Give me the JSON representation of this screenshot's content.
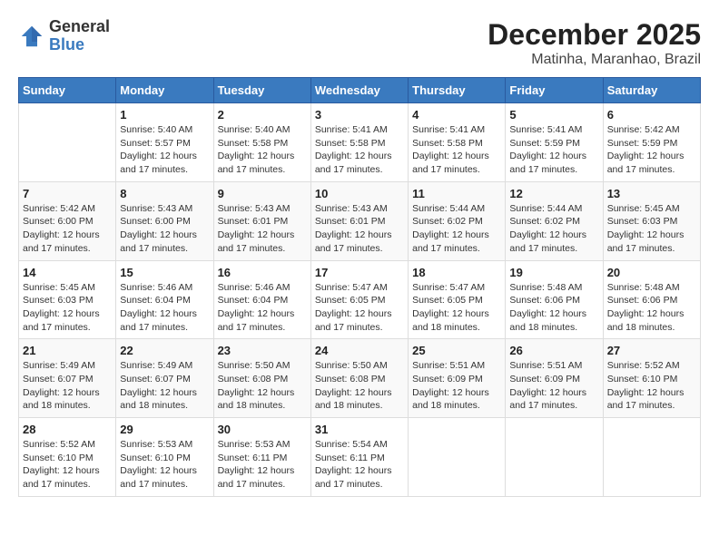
{
  "logo": {
    "general": "General",
    "blue": "Blue"
  },
  "title": {
    "month": "December 2025",
    "location": "Matinha, Maranhao, Brazil"
  },
  "weekdays": [
    "Sunday",
    "Monday",
    "Tuesday",
    "Wednesday",
    "Thursday",
    "Friday",
    "Saturday"
  ],
  "weeks": [
    [
      {
        "day": "",
        "info": ""
      },
      {
        "day": "1",
        "info": "Sunrise: 5:40 AM\nSunset: 5:57 PM\nDaylight: 12 hours\nand 17 minutes."
      },
      {
        "day": "2",
        "info": "Sunrise: 5:40 AM\nSunset: 5:58 PM\nDaylight: 12 hours\nand 17 minutes."
      },
      {
        "day": "3",
        "info": "Sunrise: 5:41 AM\nSunset: 5:58 PM\nDaylight: 12 hours\nand 17 minutes."
      },
      {
        "day": "4",
        "info": "Sunrise: 5:41 AM\nSunset: 5:58 PM\nDaylight: 12 hours\nand 17 minutes."
      },
      {
        "day": "5",
        "info": "Sunrise: 5:41 AM\nSunset: 5:59 PM\nDaylight: 12 hours\nand 17 minutes."
      },
      {
        "day": "6",
        "info": "Sunrise: 5:42 AM\nSunset: 5:59 PM\nDaylight: 12 hours\nand 17 minutes."
      }
    ],
    [
      {
        "day": "7",
        "info": "Sunrise: 5:42 AM\nSunset: 6:00 PM\nDaylight: 12 hours\nand 17 minutes."
      },
      {
        "day": "8",
        "info": "Sunrise: 5:43 AM\nSunset: 6:00 PM\nDaylight: 12 hours\nand 17 minutes."
      },
      {
        "day": "9",
        "info": "Sunrise: 5:43 AM\nSunset: 6:01 PM\nDaylight: 12 hours\nand 17 minutes."
      },
      {
        "day": "10",
        "info": "Sunrise: 5:43 AM\nSunset: 6:01 PM\nDaylight: 12 hours\nand 17 minutes."
      },
      {
        "day": "11",
        "info": "Sunrise: 5:44 AM\nSunset: 6:02 PM\nDaylight: 12 hours\nand 17 minutes."
      },
      {
        "day": "12",
        "info": "Sunrise: 5:44 AM\nSunset: 6:02 PM\nDaylight: 12 hours\nand 17 minutes."
      },
      {
        "day": "13",
        "info": "Sunrise: 5:45 AM\nSunset: 6:03 PM\nDaylight: 12 hours\nand 17 minutes."
      }
    ],
    [
      {
        "day": "14",
        "info": "Sunrise: 5:45 AM\nSunset: 6:03 PM\nDaylight: 12 hours\nand 17 minutes."
      },
      {
        "day": "15",
        "info": "Sunrise: 5:46 AM\nSunset: 6:04 PM\nDaylight: 12 hours\nand 17 minutes."
      },
      {
        "day": "16",
        "info": "Sunrise: 5:46 AM\nSunset: 6:04 PM\nDaylight: 12 hours\nand 17 minutes."
      },
      {
        "day": "17",
        "info": "Sunrise: 5:47 AM\nSunset: 6:05 PM\nDaylight: 12 hours\nand 17 minutes."
      },
      {
        "day": "18",
        "info": "Sunrise: 5:47 AM\nSunset: 6:05 PM\nDaylight: 12 hours\nand 18 minutes."
      },
      {
        "day": "19",
        "info": "Sunrise: 5:48 AM\nSunset: 6:06 PM\nDaylight: 12 hours\nand 18 minutes."
      },
      {
        "day": "20",
        "info": "Sunrise: 5:48 AM\nSunset: 6:06 PM\nDaylight: 12 hours\nand 18 minutes."
      }
    ],
    [
      {
        "day": "21",
        "info": "Sunrise: 5:49 AM\nSunset: 6:07 PM\nDaylight: 12 hours\nand 18 minutes."
      },
      {
        "day": "22",
        "info": "Sunrise: 5:49 AM\nSunset: 6:07 PM\nDaylight: 12 hours\nand 18 minutes."
      },
      {
        "day": "23",
        "info": "Sunrise: 5:50 AM\nSunset: 6:08 PM\nDaylight: 12 hours\nand 18 minutes."
      },
      {
        "day": "24",
        "info": "Sunrise: 5:50 AM\nSunset: 6:08 PM\nDaylight: 12 hours\nand 18 minutes."
      },
      {
        "day": "25",
        "info": "Sunrise: 5:51 AM\nSunset: 6:09 PM\nDaylight: 12 hours\nand 18 minutes."
      },
      {
        "day": "26",
        "info": "Sunrise: 5:51 AM\nSunset: 6:09 PM\nDaylight: 12 hours\nand 17 minutes."
      },
      {
        "day": "27",
        "info": "Sunrise: 5:52 AM\nSunset: 6:10 PM\nDaylight: 12 hours\nand 17 minutes."
      }
    ],
    [
      {
        "day": "28",
        "info": "Sunrise: 5:52 AM\nSunset: 6:10 PM\nDaylight: 12 hours\nand 17 minutes."
      },
      {
        "day": "29",
        "info": "Sunrise: 5:53 AM\nSunset: 6:10 PM\nDaylight: 12 hours\nand 17 minutes."
      },
      {
        "day": "30",
        "info": "Sunrise: 5:53 AM\nSunset: 6:11 PM\nDaylight: 12 hours\nand 17 minutes."
      },
      {
        "day": "31",
        "info": "Sunrise: 5:54 AM\nSunset: 6:11 PM\nDaylight: 12 hours\nand 17 minutes."
      },
      {
        "day": "",
        "info": ""
      },
      {
        "day": "",
        "info": ""
      },
      {
        "day": "",
        "info": ""
      }
    ]
  ]
}
